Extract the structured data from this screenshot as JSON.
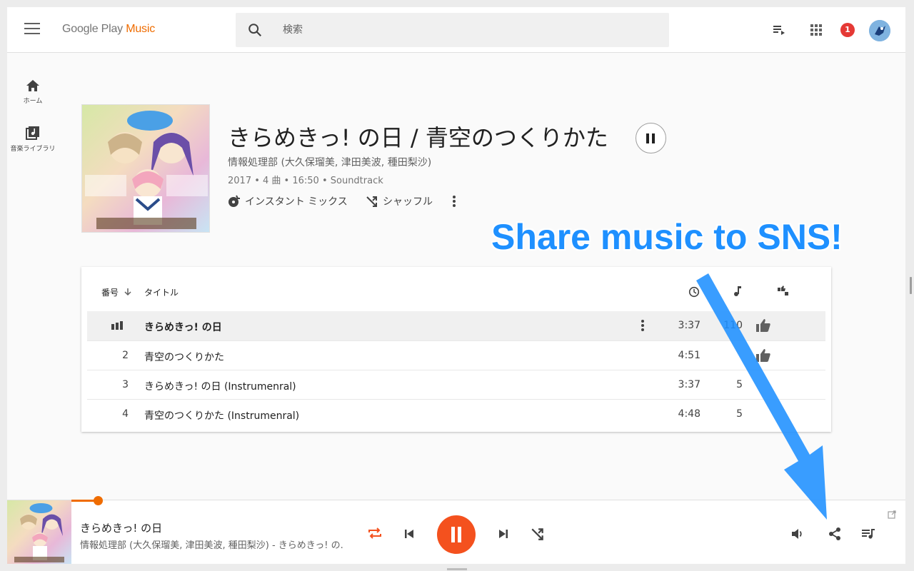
{
  "header": {
    "logo_google": "Google Play",
    "logo_music": "Music",
    "search_placeholder": "検索",
    "notification_count": "1"
  },
  "sidebar": {
    "items": [
      {
        "label": "ホーム",
        "icon": "home-icon"
      },
      {
        "label": "音楽ライブラリ",
        "icon": "music-library-icon"
      }
    ]
  },
  "album": {
    "title": "きらめきっ! の日 / 青空のつくりかた",
    "artist": "情報処理部 (大久保瑠美, 津田美波, 種田梨沙)",
    "meta": "2017 • 4 曲 • 16:50 • Soundtrack",
    "instant_mix_label": "インスタント ミックス",
    "shuffle_label": "シャッフル"
  },
  "callout": "Share music to SNS!",
  "table": {
    "col_number": "番号",
    "col_title": "タイトル",
    "rows": [
      {
        "number": "",
        "title": "きらめきっ! の日",
        "duration": "3:37",
        "plays": "110",
        "thumb": true,
        "playing": true
      },
      {
        "number": "2",
        "title": "青空のつくりかた",
        "duration": "4:51",
        "plays": "",
        "thumb": true,
        "playing": false
      },
      {
        "number": "3",
        "title": "きらめきっ! の日 (Instrumenral)",
        "duration": "3:37",
        "plays": "5",
        "thumb": false,
        "playing": false
      },
      {
        "number": "4",
        "title": "青空のつくりかた (Instrumenral)",
        "duration": "4:48",
        "plays": "5",
        "thumb": false,
        "playing": false
      }
    ]
  },
  "player": {
    "title": "きらめきっ! の日",
    "subtitle": "情報処理部 (大久保瑠美, 津田美波, 種田梨沙) - きらめきっ! の...",
    "progress": 0.1
  },
  "colors": {
    "accent": "#ef6c00",
    "play_button": "#f4511e",
    "callout": "#1e90ff",
    "badge": "#e53935"
  }
}
